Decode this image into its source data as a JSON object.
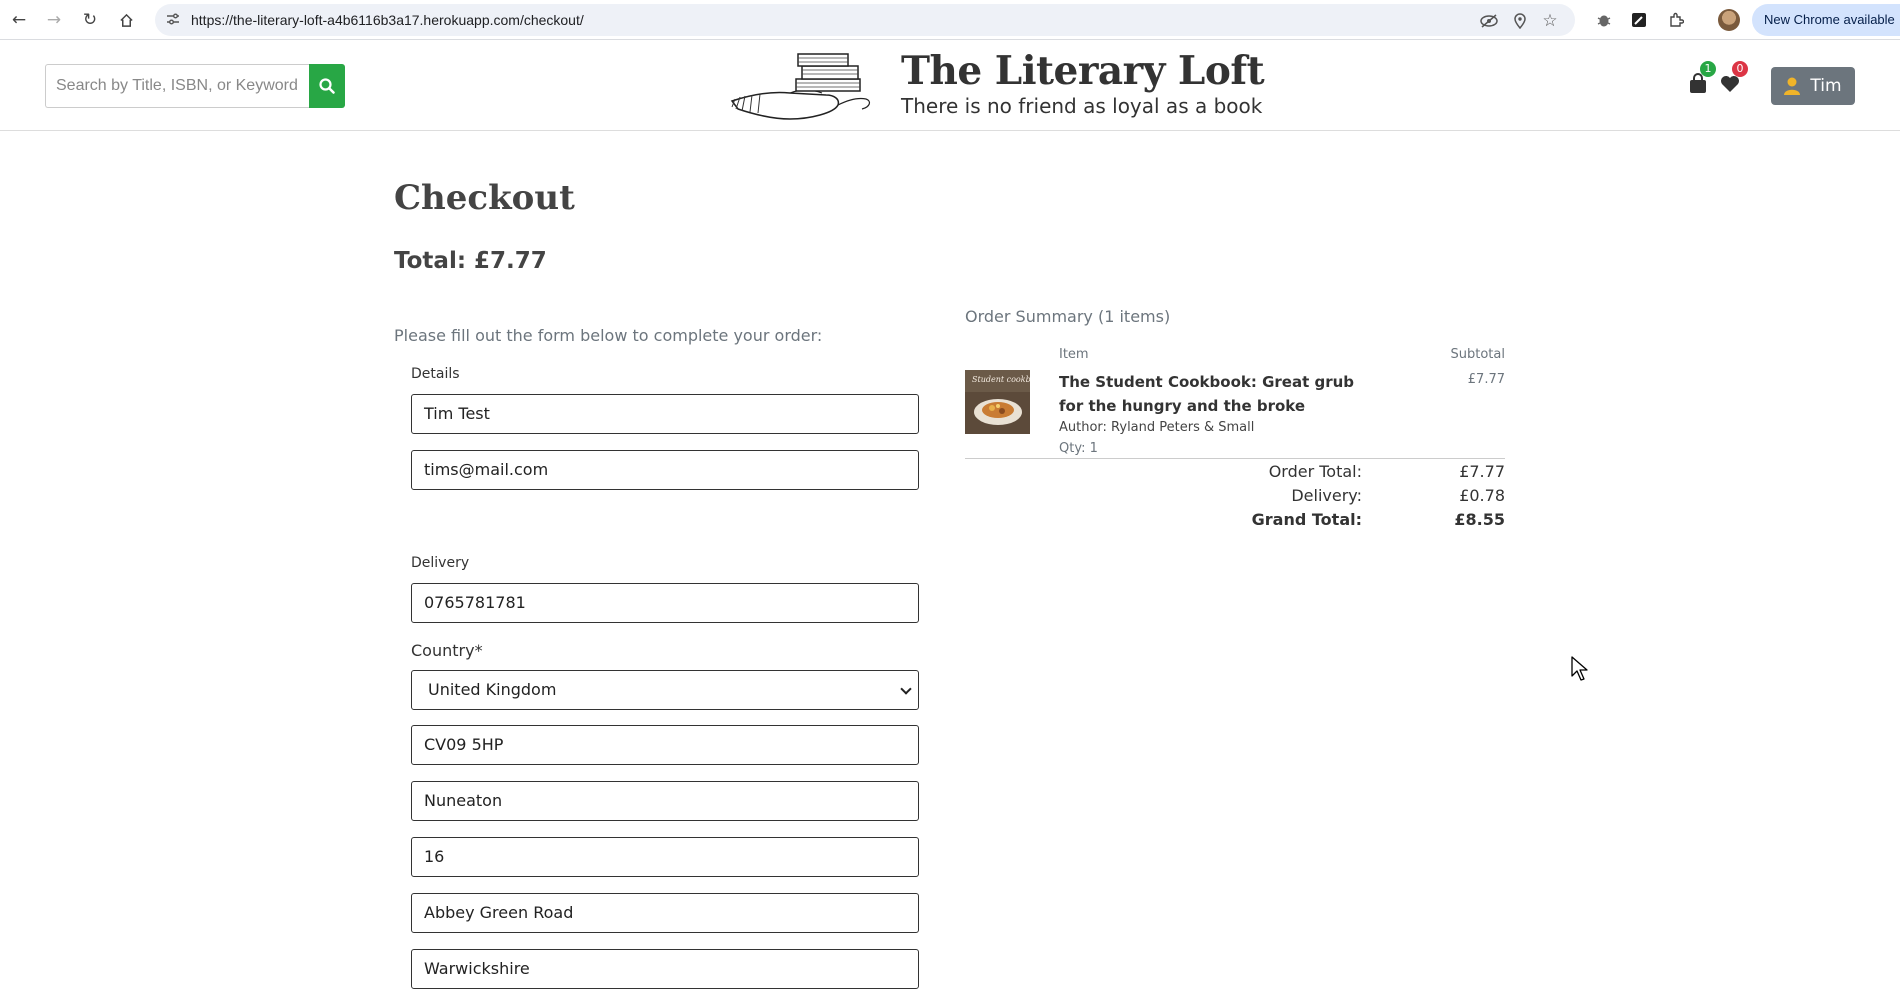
{
  "browser": {
    "url": "https://the-literary-loft-a4b6116b3a17.herokuapp.com/checkout/",
    "update_label": "New Chrome available"
  },
  "header": {
    "search_placeholder": "Search by Title, ISBN, or Keyword",
    "brand_title": "The Literary Loft",
    "brand_tagline": "There is no friend as loyal as a book",
    "bag_count": "1",
    "wishlist_count": "0",
    "user_name": "Tim",
    "colors": {
      "search_button": "#28a745",
      "bag_badge": "#28a745",
      "wishlist_badge": "#dc3545",
      "user_button": "#6c757d"
    }
  },
  "checkout": {
    "title": "Checkout",
    "total": "Total: £7.77",
    "intro": "Please fill out the form below to complete your order:",
    "details_legend": "Details",
    "full_name": "Tim  Test",
    "email": "tims@mail.com",
    "delivery_legend": "Delivery",
    "phone": "0765781781",
    "country_label": "Country*",
    "country": "United Kingdom",
    "postcode": "CV09 5HP",
    "town": "Nuneaton",
    "street1": "16",
    "street2": "Abbey Green Road",
    "county": "Warwickshire"
  },
  "summary": {
    "title": "Order Summary (1 items)",
    "col_item": "Item",
    "col_subtotal": "Subtotal",
    "items": [
      {
        "title": "The Student Cookbook: Great grub for the hungry and the broke",
        "author": "Author: Ryland Peters & Small",
        "qty": "Qty: 1",
        "subtotal": "£7.77",
        "thumb_text": "Student cookbook"
      }
    ],
    "order_total_label": "Order Total:",
    "order_total": "£7.77",
    "delivery_label": "Delivery:",
    "delivery": "£0.78",
    "grand_total_label": "Grand Total:",
    "grand_total": "£8.55"
  }
}
